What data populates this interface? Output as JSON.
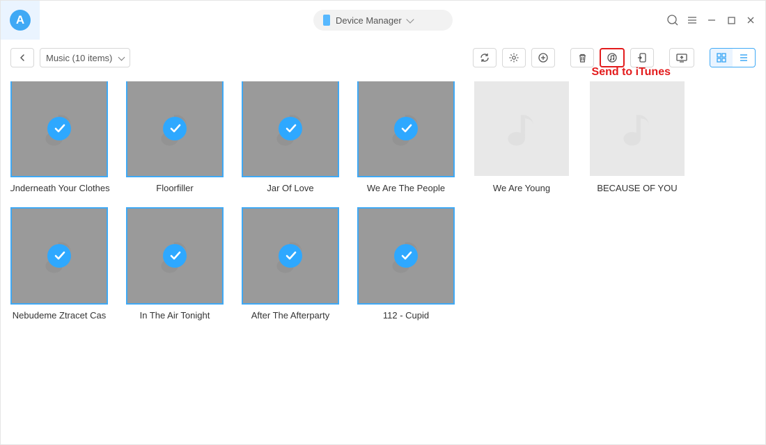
{
  "header": {
    "device_label": "Device Manager"
  },
  "toolbar": {
    "breadcrumb_label": "Music (10 items)",
    "callout": "Send to iTunes"
  },
  "items": [
    {
      "title": "Underneath Your Clothes",
      "selected": true
    },
    {
      "title": "Floorfiller",
      "selected": true
    },
    {
      "title": "Jar Of Love",
      "selected": true
    },
    {
      "title": "We Are The People",
      "selected": true
    },
    {
      "title": "We Are Young",
      "selected": false
    },
    {
      "title": "BECAUSE OF YOU",
      "selected": false
    },
    {
      "title": "Nebudeme Ztracet Cas",
      "selected": true
    },
    {
      "title": "In The Air Tonight",
      "selected": true
    },
    {
      "title": "After The Afterparty",
      "selected": true
    },
    {
      "title": "112 - Cupid",
      "selected": true
    }
  ]
}
